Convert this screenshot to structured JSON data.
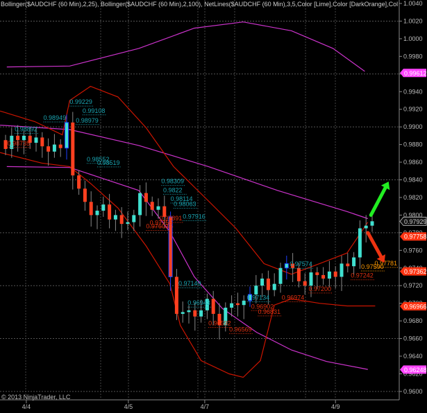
{
  "header": {
    "indicators": "Bollinger($AUDCHF (60 Min),2,25), Bollinger($AUDCHF (60 Min),2,100), NetLines($AUDCHF (60 Min),3,5,Color [Lime],Color [DarkOrange],Color [Te"
  },
  "copyright": "© 2013 NinjaTrader, LLC",
  "colors": {
    "up": "#40e0d0",
    "down": "#ff4020",
    "blue": "#1e40ff",
    "bb25": "#cc1500",
    "bb100": "#cc33cc",
    "cyan_label": "#1aa3b0",
    "red_label": "#e03010",
    "orange_label": "#ff9900",
    "green_arrow": "#22ee22",
    "red_arrow": "#ee3311"
  },
  "chart_data": {
    "type": "candlestick",
    "instrument": "$AUDCHF (60 Min)",
    "ylim": [
      0.9595,
      1.0042
    ],
    "y_ticks": [
      "1.0040",
      "1.0020",
      "1.0000",
      "0.9980",
      "0.9960",
      "0.9940",
      "0.9920",
      "0.9900",
      "0.9880",
      "0.9860",
      "0.9840",
      "0.9820",
      "0.9800",
      "0.9780",
      "0.9760",
      "0.9740",
      "0.9720",
      "0.9700",
      "0.9680",
      "0.9660",
      "0.9640",
      "0.9620",
      "0.9600"
    ],
    "x_ticks": [
      {
        "label": "4/4",
        "index": 3.4
      },
      {
        "label": "4/5",
        "index": 20.1
      },
      {
        "label": "4/7",
        "index": 32.6
      },
      {
        "label": "4/9",
        "index": 54
      }
    ],
    "open_first": 0.9885,
    "closes": [
      0.9875,
      0.989,
      0.9885,
      0.989,
      0.9882,
      0.9888,
      0.9878,
      0.9872,
      0.988,
      0.9876,
      0.9905,
      0.9845,
      0.983,
      0.9815,
      0.98,
      0.9805,
      0.9812,
      0.9795,
      0.98,
      0.979,
      0.9792,
      0.98,
      0.9825,
      0.9815,
      0.9806,
      0.981,
      0.9798,
      0.973,
      0.9688,
      0.969,
      0.9692,
      0.9685,
      0.9692,
      0.9705,
      0.9688,
      0.9675,
      0.9695,
      0.97,
      0.9698,
      0.9703,
      0.971,
      0.972,
      0.9728,
      0.9715,
      0.9722,
      0.974,
      0.9745,
      0.974,
      0.9725,
      0.972,
      0.9735,
      0.9732,
      0.9728,
      0.9736,
      0.973,
      0.9745,
      0.9742,
      0.9752,
      0.9785,
      0.9788,
      0.9793
    ],
    "blue_bars": [
      10,
      27,
      40,
      46
    ],
    "bands": [
      {
        "name": "Bollinger 100 upper",
        "color": "bb100",
        "points": [
          [
            0.2,
            0.9968
          ],
          [
            10.5,
            0.9969
          ],
          [
            21.8,
            0.9989
          ],
          [
            30.9,
            1.0012
          ],
          [
            38.9,
            1.0019
          ],
          [
            46.8,
            1.0009
          ],
          [
            53.6,
            0.9989
          ],
          [
            58.8,
            0.9963
          ]
        ]
      },
      {
        "name": "Bollinger 100 middle",
        "color": "bb100",
        "points": [
          [
            -0.9,
            0.9902
          ],
          [
            10.5,
            0.9897
          ],
          [
            21.8,
            0.9879
          ],
          [
            33.2,
            0.9855
          ],
          [
            44.5,
            0.9828
          ],
          [
            55.9,
            0.9804
          ],
          [
            59.3,
            0.9796
          ]
        ]
      },
      {
        "name": "Bollinger 100 lower",
        "color": "bb100",
        "points": [
          [
            0.2,
            0.9855
          ],
          [
            10.5,
            0.9854
          ],
          [
            21.8,
            0.9828
          ],
          [
            26.9,
            0.9781
          ],
          [
            30.9,
            0.973
          ],
          [
            35.5,
            0.9694
          ],
          [
            41.1,
            0.9667
          ],
          [
            46.8,
            0.9647
          ],
          [
            52.5,
            0.9634
          ],
          [
            59.3,
            0.9625
          ]
        ]
      },
      {
        "name": "Bollinger 25 upper",
        "color": "bb25",
        "points": [
          [
            -0.9,
            0.9918
          ],
          [
            4.8,
            0.9906
          ],
          [
            9.3,
            0.9891
          ],
          [
            10.5,
            0.993
          ],
          [
            13.9,
            0.9946
          ],
          [
            18.4,
            0.9934
          ],
          [
            23,
            0.9899
          ],
          [
            27.5,
            0.9855
          ],
          [
            33.2,
            0.9816
          ],
          [
            37.7,
            0.9785
          ],
          [
            42.3,
            0.9745
          ],
          [
            46.8,
            0.9733
          ],
          [
            51.4,
            0.9745
          ],
          [
            55.9,
            0.9757
          ],
          [
            59.3,
            0.9792
          ]
        ]
      },
      {
        "name": "Bollinger 25 lower",
        "color": "bb25",
        "points": [
          [
            -0.9,
            0.9871
          ],
          [
            5.9,
            0.9859
          ],
          [
            10.5,
            0.9855
          ],
          [
            13.9,
            0.9836
          ],
          [
            18.4,
            0.9808
          ],
          [
            23,
            0.9765
          ],
          [
            26.9,
            0.9722
          ],
          [
            28.6,
            0.9675
          ],
          [
            32,
            0.9635
          ],
          [
            36.6,
            0.962
          ],
          [
            38.9,
            0.9616
          ],
          [
            41.7,
            0.9635
          ],
          [
            44,
            0.9698
          ],
          [
            46.8,
            0.9705
          ],
          [
            51.4,
            0.97
          ],
          [
            55.9,
            0.9697
          ],
          [
            60.5,
            0.9697
          ]
        ]
      }
    ],
    "level_labels": [
      {
        "text": "0.99229",
        "color": "cyan_label",
        "index": 10.5,
        "price": 0.9926
      },
      {
        "text": "0.99108",
        "color": "cyan_label",
        "index": 12.6,
        "price": 0.9916
      },
      {
        "text": "0.98979",
        "color": "cyan_label",
        "index": 11.5,
        "price": 0.9905
      },
      {
        "text": "0.98949",
        "color": "cyan_label",
        "index": 6.2,
        "price": 0.9908
      },
      {
        "text": "0.98892",
        "color": "cyan_label",
        "index": 1.5,
        "price": 0.9895
      },
      {
        "text": "0.98552",
        "color": "cyan_label",
        "index": 13.3,
        "price": 0.9861
      },
      {
        "text": "0.98519",
        "color": "cyan_label",
        "index": 15,
        "price": 0.9857
      },
      {
        "text": "0.98309",
        "color": "cyan_label",
        "index": 25.5,
        "price": 0.9836
      },
      {
        "text": "0.9822",
        "color": "cyan_label",
        "index": 25.8,
        "price": 0.9826
      },
      {
        "text": "0.98114",
        "color": "cyan_label",
        "index": 27,
        "price": 0.9816
      },
      {
        "text": "0.98063",
        "color": "cyan_label",
        "index": 27.5,
        "price": 0.981
      },
      {
        "text": "0.97916",
        "color": "cyan_label",
        "index": 29,
        "price": 0.9796
      },
      {
        "text": "0.97149",
        "color": "cyan_label",
        "index": 28.3,
        "price": 0.972
      },
      {
        "text": "0.96943",
        "color": "cyan_label",
        "index": 29.8,
        "price": 0.9698
      },
      {
        "text": "0.97134",
        "color": "cyan_label",
        "index": 39.5,
        "price": 0.9704
      },
      {
        "text": "0.97574",
        "color": "cyan_label",
        "index": 46.5,
        "price": 0.9742
      },
      {
        "text": "0.98735",
        "color": "red_label",
        "index": 0.3,
        "price": 0.9879
      },
      {
        "text": "0.97891",
        "color": "red_label",
        "index": 25.2,
        "price": 0.9794
      },
      {
        "text": "0.97755",
        "color": "red_label",
        "index": 23.6,
        "price": 0.9789
      },
      {
        "text": "0.97603",
        "color": "red_label",
        "index": 23,
        "price": 0.9785
      },
      {
        "text": "0.96592",
        "color": "red_label",
        "index": 33.2,
        "price": 0.9675
      },
      {
        "text": "0.96569",
        "color": "red_label",
        "index": 36.6,
        "price": 0.9668
      },
      {
        "text": "0.96902",
        "color": "red_label",
        "index": 40.2,
        "price": 0.9694
      },
      {
        "text": "0.96831",
        "color": "red_label",
        "index": 41.3,
        "price": 0.9688
      },
      {
        "text": "0.96974",
        "color": "red_label",
        "index": 45.2,
        "price": 0.9704
      },
      {
        "text": "0.97200",
        "color": "red_label",
        "index": 49.6,
        "price": 0.9714
      },
      {
        "text": "0.97242",
        "color": "red_label",
        "index": 56.5,
        "price": 0.9729
      },
      {
        "text": "0.97590",
        "color": "orange_label",
        "index": 58.2,
        "price": 0.9739
      },
      {
        "text": "0.97781",
        "color": "orange_label",
        "index": 60.4,
        "price": 0.9743
      }
    ],
    "price_tags": [
      {
        "text": "0.99612",
        "price": 0.99612,
        "bg": "#ff44ff",
        "fg": "#ffffff"
      },
      {
        "text": "0.97929",
        "price": 0.97929,
        "bg": "#111111",
        "fg": "#cccccc"
      },
      {
        "text": "0.97758",
        "price": 0.97758,
        "bg": "#ff3311",
        "fg": "#ffffff"
      },
      {
        "text": "0.97362",
        "price": 0.97362,
        "bg": "#ff3311",
        "fg": "#ffffff"
      },
      {
        "text": "0.96966",
        "price": 0.96966,
        "bg": "#ff3311",
        "fg": "#ffffff"
      },
      {
        "text": "0.96248",
        "price": 0.96248,
        "bg": "#ff44ff",
        "fg": "#ffffff"
      }
    ],
    "annotations": [
      {
        "type": "arrow-up",
        "color": "green_arrow",
        "from": [
          59.8,
          0.98
        ],
        "to": [
          62.7,
          0.9838
        ]
      },
      {
        "type": "arrow-down",
        "color": "red_arrow",
        "from": [
          59.3,
          0.978
        ],
        "to": [
          62,
          0.9746
        ]
      }
    ]
  }
}
